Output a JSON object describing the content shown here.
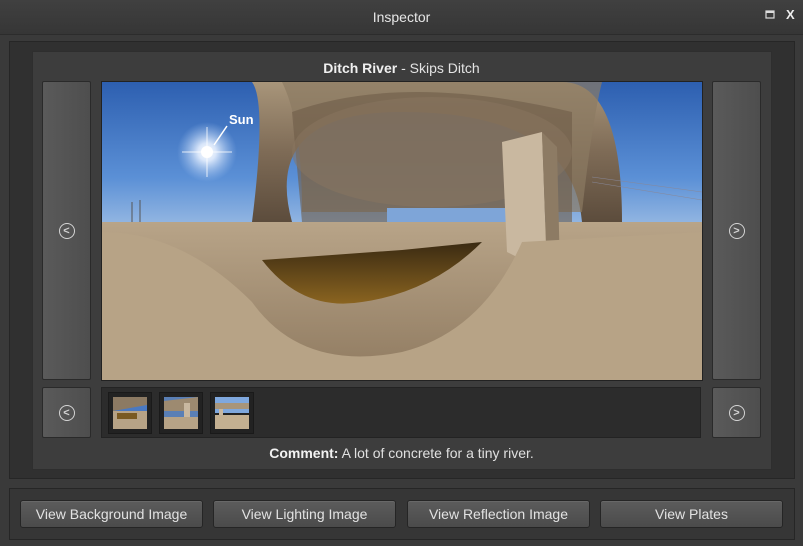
{
  "window": {
    "title": "Inspector"
  },
  "image": {
    "name": "Ditch River",
    "separator": " - ",
    "subtitle": "Skips Ditch",
    "sun_label": "Sun"
  },
  "comment": {
    "label": "Comment:",
    "text": " A lot of concrete for a tiny river."
  },
  "thumbnails": [
    {
      "name": "thumbnail-1"
    },
    {
      "name": "thumbnail-2"
    },
    {
      "name": "thumbnail-3"
    }
  ],
  "buttons": {
    "background": "View Background Image",
    "lighting": "View Lighting Image",
    "reflection": "View Reflection Image",
    "plates": "View Plates"
  },
  "icons": {
    "prev": "circle-left-arrow-icon",
    "next": "circle-right-arrow-icon",
    "restore": "restore-window-icon",
    "close": "close-x-icon"
  },
  "colors": {
    "background": "#3a3a3a",
    "panel": "#303030",
    "button": "#555555"
  }
}
